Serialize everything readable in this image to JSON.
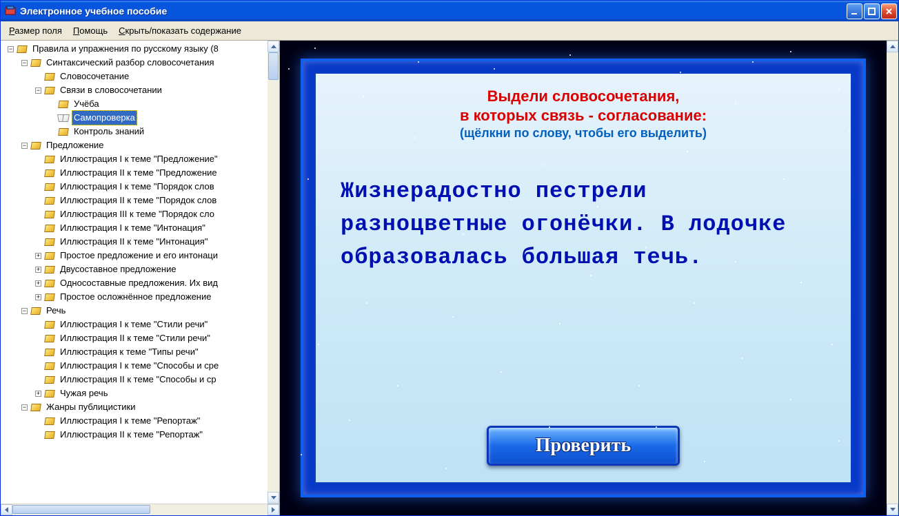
{
  "window": {
    "title": "Электронное учебное пособие"
  },
  "menu": {
    "field_size": "Размер поля",
    "help": "Помощь",
    "toggle_toc": "Скрыть/показать содержание"
  },
  "tree": [
    {
      "indent": 0,
      "exp": "-",
      "icon": "closed",
      "label": "Правила и упражнения по русскому языку (8",
      "sel": false
    },
    {
      "indent": 1,
      "exp": "-",
      "icon": "closed",
      "label": "Синтаксический разбор словосочетания",
      "sel": false
    },
    {
      "indent": 2,
      "exp": "",
      "icon": "closed",
      "label": "Словосочетание",
      "sel": false
    },
    {
      "indent": 2,
      "exp": "-",
      "icon": "closed",
      "label": "Связи в словосочетании",
      "sel": false
    },
    {
      "indent": 3,
      "exp": "",
      "icon": "closed",
      "label": "Учёба",
      "sel": false
    },
    {
      "indent": 3,
      "exp": "",
      "icon": "open",
      "label": "Самопроверка",
      "sel": true
    },
    {
      "indent": 3,
      "exp": "",
      "icon": "closed",
      "label": "Контроль знаний",
      "sel": false
    },
    {
      "indent": 1,
      "exp": "-",
      "icon": "closed",
      "label": "Предложение",
      "sel": false
    },
    {
      "indent": 2,
      "exp": "",
      "icon": "closed",
      "label": "Иллюстрация I к теме \"Предложение\"",
      "sel": false
    },
    {
      "indent": 2,
      "exp": "",
      "icon": "closed",
      "label": "Иллюстрация II к теме \"Предложение",
      "sel": false
    },
    {
      "indent": 2,
      "exp": "",
      "icon": "closed",
      "label": "Иллюстрация I к теме \"Порядок слов",
      "sel": false
    },
    {
      "indent": 2,
      "exp": "",
      "icon": "closed",
      "label": "Иллюстрация II к теме \"Порядок слов",
      "sel": false
    },
    {
      "indent": 2,
      "exp": "",
      "icon": "closed",
      "label": "Иллюстрация III к теме \"Порядок сло",
      "sel": false
    },
    {
      "indent": 2,
      "exp": "",
      "icon": "closed",
      "label": "Иллюстрация I к теме \"Интонация\"",
      "sel": false
    },
    {
      "indent": 2,
      "exp": "",
      "icon": "closed",
      "label": "Иллюстрация II к теме \"Интонация\"",
      "sel": false
    },
    {
      "indent": 2,
      "exp": "+",
      "icon": "closed",
      "label": "Простое предложение и его интонаци",
      "sel": false
    },
    {
      "indent": 2,
      "exp": "+",
      "icon": "closed",
      "label": "Двусоставное предложение",
      "sel": false
    },
    {
      "indent": 2,
      "exp": "+",
      "icon": "closed",
      "label": "Односоставные предложения. Их вид",
      "sel": false
    },
    {
      "indent": 2,
      "exp": "+",
      "icon": "closed",
      "label": "Простое осложнённое предложение",
      "sel": false
    },
    {
      "indent": 1,
      "exp": "-",
      "icon": "closed",
      "label": "Речь",
      "sel": false
    },
    {
      "indent": 2,
      "exp": "",
      "icon": "closed",
      "label": "Иллюстрация I к теме \"Стили речи\"",
      "sel": false
    },
    {
      "indent": 2,
      "exp": "",
      "icon": "closed",
      "label": "Иллюстрация II к теме \"Стили речи\"",
      "sel": false
    },
    {
      "indent": 2,
      "exp": "",
      "icon": "closed",
      "label": "Иллюстрация к теме \"Типы речи\"",
      "sel": false
    },
    {
      "indent": 2,
      "exp": "",
      "icon": "closed",
      "label": "Иллюстрация I к теме \"Способы и сре",
      "sel": false
    },
    {
      "indent": 2,
      "exp": "",
      "icon": "closed",
      "label": "Иллюстрация II к теме \"Способы и ср",
      "sel": false
    },
    {
      "indent": 2,
      "exp": "+",
      "icon": "closed",
      "label": "Чужая речь",
      "sel": false
    },
    {
      "indent": 1,
      "exp": "-",
      "icon": "closed",
      "label": "Жанры публицистики",
      "sel": false
    },
    {
      "indent": 2,
      "exp": "",
      "icon": "closed",
      "label": "Иллюстрация I к теме \"Репортаж\"",
      "sel": false
    },
    {
      "indent": 2,
      "exp": "",
      "icon": "closed",
      "label": "Иллюстрация II к теме \"Репортаж\"",
      "sel": false
    }
  ],
  "lesson": {
    "instr1": "Выдели словосочетания,",
    "instr2": "в которых связь - согласование:",
    "instr3": "(щёлкни по слову, чтобы его выделить)",
    "text": "Жизнерадостно пестрели разноцветные огонёчки. В лодочке образовалась большая течь.",
    "check_label": "Проверить"
  }
}
